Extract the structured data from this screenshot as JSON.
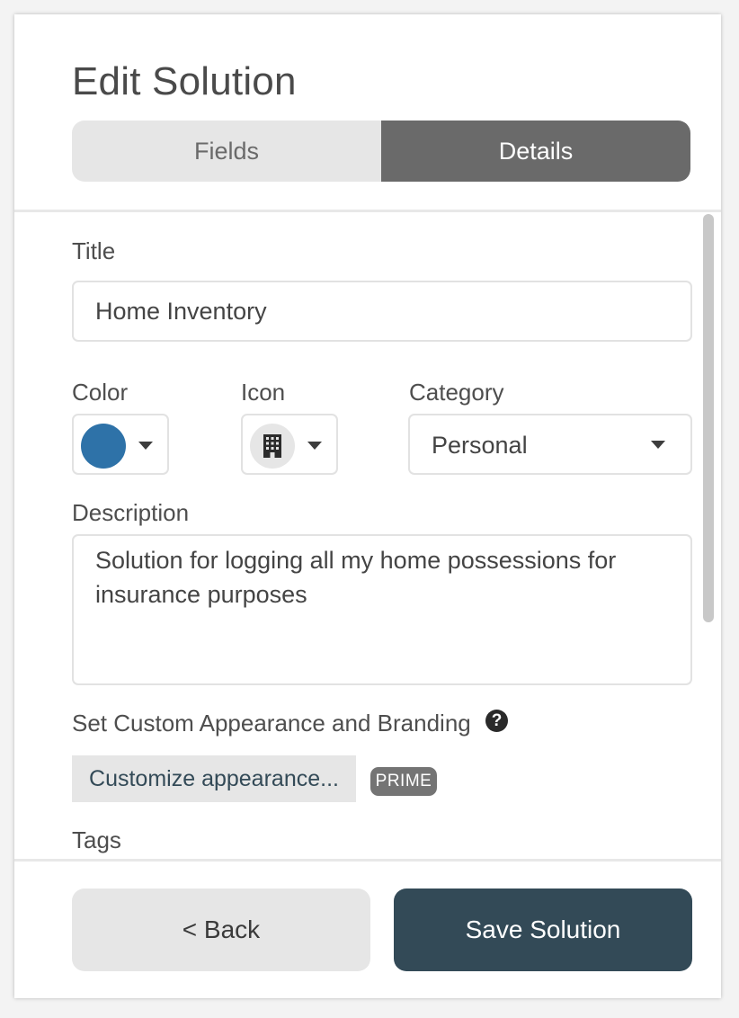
{
  "dialog": {
    "title": "Edit Solution"
  },
  "tabs": [
    {
      "label": "Fields",
      "active": false
    },
    {
      "label": "Details",
      "active": true
    }
  ],
  "form": {
    "title_label": "Title",
    "title_value": "Home Inventory",
    "color_label": "Color",
    "color_value": "#2e72a8",
    "icon_label": "Icon",
    "icon_value": "building-icon",
    "category_label": "Category",
    "category_value": "Personal",
    "description_label": "Description",
    "description_value": "Solution for logging all my home possessions for insurance purposes",
    "branding_label": "Set Custom Appearance and Branding",
    "customize_button": "Customize appearance...",
    "prime_badge": "PRIME",
    "tags_label": "Tags"
  },
  "footer": {
    "back_label": "< Back",
    "save_label": "Save Solution"
  },
  "colors": {
    "accent": "#334a57",
    "active_tab": "#6a6a6a",
    "inactive_tab": "#e6e6e6"
  }
}
